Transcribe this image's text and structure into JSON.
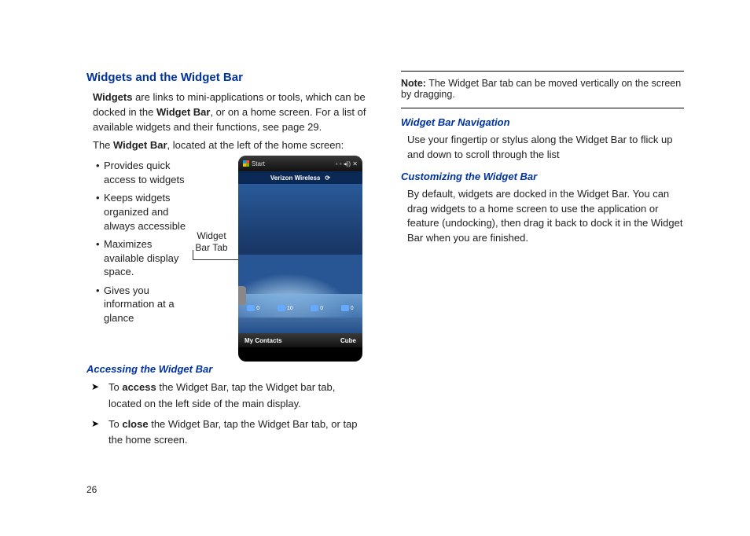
{
  "page_number": "26",
  "left": {
    "title": "Widgets and the Widget Bar",
    "intro_parts": {
      "p1a": "Widgets",
      "p1b": " are links to mini-applications or tools, which can be docked in the ",
      "p1c": "Widget Bar",
      "p1d": ", or on a home screen. For a list of available widgets and their functions, see page 29."
    },
    "intro2_parts": {
      "a": "The ",
      "b": "Widget Bar",
      "c": ", located at the left of the home screen:"
    },
    "bullets": [
      "Provides quick access to widgets",
      "Keeps widgets organized and always accessible",
      "Maximizes available display space.",
      "Gives you information at a glance"
    ],
    "callout": "Widget Bar Tab",
    "sub1": "Accessing the Widget Bar",
    "arrow1": {
      "a": "To ",
      "b": "access",
      "c": " the Widget Bar, tap the Widget bar tab, located on the left side of the main display."
    },
    "arrow2": {
      "a": "To ",
      "b": "close",
      "c": " the Widget Bar, tap the Widget Bar tab, or tap the home screen."
    }
  },
  "phone": {
    "start": "Start",
    "brand": "Verizon Wireless",
    "dock0": "0",
    "dock1": "10",
    "dock2": "0",
    "dock3": "0",
    "soft_left": "My Contacts",
    "soft_right": "Cube"
  },
  "right": {
    "note_label": "Note:",
    "note_text": " The Widget Bar tab can be moved vertically on the screen by dragging.",
    "sub1": "Widget Bar Navigation",
    "p1": "Use your fingertip or stylus along the Widget Bar to flick up and down to scroll through the list",
    "sub2": "Customizing the Widget Bar",
    "p2": "By default, widgets are docked in the Widget Bar.  You can drag widgets to a home screen to use the application or feature (undocking), then drag it back to dock it in the Widget Bar when you are finished."
  }
}
